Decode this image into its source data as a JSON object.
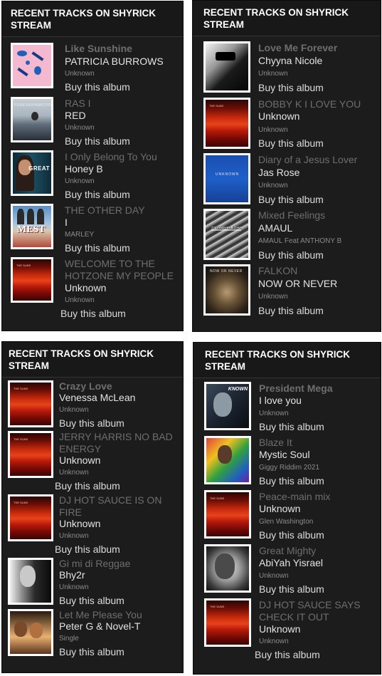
{
  "panel_title": "RECENT TRACKS ON SHYRICK STREAM",
  "buy_label": "Buy this album",
  "panels": [
    {
      "tracks": [
        {
          "title": "Like Sunshine",
          "artist": "PATRICIA BURROWS",
          "label": "Unknown",
          "art": "pink-abstract-art"
        },
        {
          "title": "RAS I",
          "artist": "RED",
          "label": "Unknown",
          "art": "balloon-landscape-art"
        },
        {
          "title": "I Only Belong To You",
          "artist": "Honey B",
          "label": "Unknown",
          "art": "woman-portrait-art"
        },
        {
          "title": "THE OTHER DAY",
          "artist": "I",
          "label": "MARLEY",
          "art": "mest-band-art"
        },
        {
          "title": "WELCOME TO THE HOTZONE MY PEOPLE",
          "artist": "Unknown",
          "label": "Unknown",
          "art": "red-sunset-art"
        }
      ]
    },
    {
      "tracks": [
        {
          "title": "Love Me Forever",
          "artist": "Chyyna Nicole",
          "label": "Unknown",
          "art": "bw-portrait-art"
        },
        {
          "title": "BOBBY K I LOVE YOU",
          "artist": "Unknown",
          "label": "Unknown",
          "art": "red-sunset-art"
        },
        {
          "title": "Diary of a Jesus Lover",
          "artist": "Jas Rose",
          "label": "Unknown",
          "art": "blue-cover-art"
        },
        {
          "title": "Mixed Feelings",
          "artist": "AMAUL",
          "label": "AMAUL Feat ANTHONY B",
          "art": "feather-texture-art"
        },
        {
          "title": "FALKON",
          "artist": "NOW OR NEVER",
          "label": "Unknown",
          "art": "fist-rings-art"
        }
      ]
    },
    {
      "tracks": [
        {
          "title": "Crazy Love",
          "artist": "Venessa McLean",
          "label": "Unknown",
          "art": "red-sunset-art"
        },
        {
          "title": "JERRY HARRIS NO BAD ENERGY",
          "artist": "Unknown",
          "label": "Unknown",
          "art": "red-sunset-art"
        },
        {
          "title": "DJ HOT SAUCE IS ON FIRE",
          "artist": "Unknown",
          "label": "Unknown",
          "art": "red-sunset-art"
        },
        {
          "title": "Gi mi di Reggae",
          "artist": "Bhy2r",
          "label": "Unknown",
          "art": "man-portrait-art"
        },
        {
          "title": "Let Me Please You",
          "artist": "Peter G & Novel-T",
          "label": "Single",
          "art": "couple-portrait-art"
        }
      ]
    },
    {
      "tracks": [
        {
          "title": "President Mega",
          "artist": "I love you",
          "label": "Unknown",
          "art": "known-cover-art"
        },
        {
          "title": "Blaze It",
          "artist": "Mystic Soul",
          "label": "Giggy Riddim 2021",
          "art": "giggy-riddim-art"
        },
        {
          "title": "Peace-main mix",
          "artist": "Unknown",
          "label": "Glen Washington",
          "art": "red-sunset-art"
        },
        {
          "title": "Great Mighty",
          "artist": "AbiYah Yisrael",
          "label": "Unknown",
          "art": "tribal-face-art"
        },
        {
          "title": "DJ HOT SAUCE SAYS CHECK IT OUT",
          "artist": "Unknown",
          "label": "Unknown",
          "art": "red-sunset-art"
        }
      ]
    }
  ]
}
